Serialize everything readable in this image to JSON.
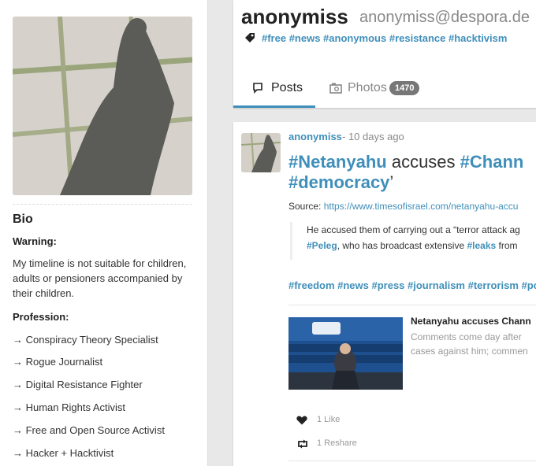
{
  "profile": {
    "name": "anonymiss",
    "handle": "anonymiss@despora.de",
    "tags": "#free #news #anonymous #resistance #hacktivism",
    "tabs": {
      "posts_label": "Posts",
      "photos_label": "Photos",
      "photos_count": "1470"
    }
  },
  "sidebar": {
    "bio_title": "Bio",
    "warning_heading": "Warning:",
    "warning_text": "My timeline is not suitable for children, adults or pensioners accompanied by their children.",
    "profession_heading": "Profession:",
    "professions": [
      "→ Conspiracy Theory Specialist",
      "→ Rogue Journalist",
      "→ Digital Resistance Fighter",
      "→ Human Rights Activist",
      "→ Free and Open Source Activist",
      "→ Hacker + Hacktivist"
    ]
  },
  "post": {
    "author": "anonymiss",
    "time": "- 10 days ago",
    "title_tag1": "#Netanyahu",
    "title_text": " accuses ",
    "title_tag2": "#Chann",
    "title_line2_tag": "#democracy",
    "title_line2_end": "’",
    "source_label": "Source: ",
    "source_url": "https://www.timesofisrael.com/netanyahu-accu",
    "quote_line1": "He accused them of carrying out a “terror attack ag",
    "quote_tag1": "#Peleg",
    "quote_mid": ", who has broadcast extensive ",
    "quote_tag2": "#leaks",
    "quote_end": " from",
    "tags": "#freedom #news #press #journalism #terrorism #po",
    "embed": {
      "title": "Netanyahu accuses Chann",
      "desc_line1": "Comments come day after",
      "desc_line2": "cases against him; commen"
    },
    "like_label": "1 Like",
    "reshare_label": "1 Reshare"
  },
  "colors": {
    "accent": "#3f8fba",
    "background": "#e8e8e8"
  },
  "icons": {
    "tag": "tag-icon",
    "posts": "speech-bubble-icon",
    "photos": "camera-icon",
    "like": "heart-icon",
    "reshare": "reshare-icon"
  }
}
